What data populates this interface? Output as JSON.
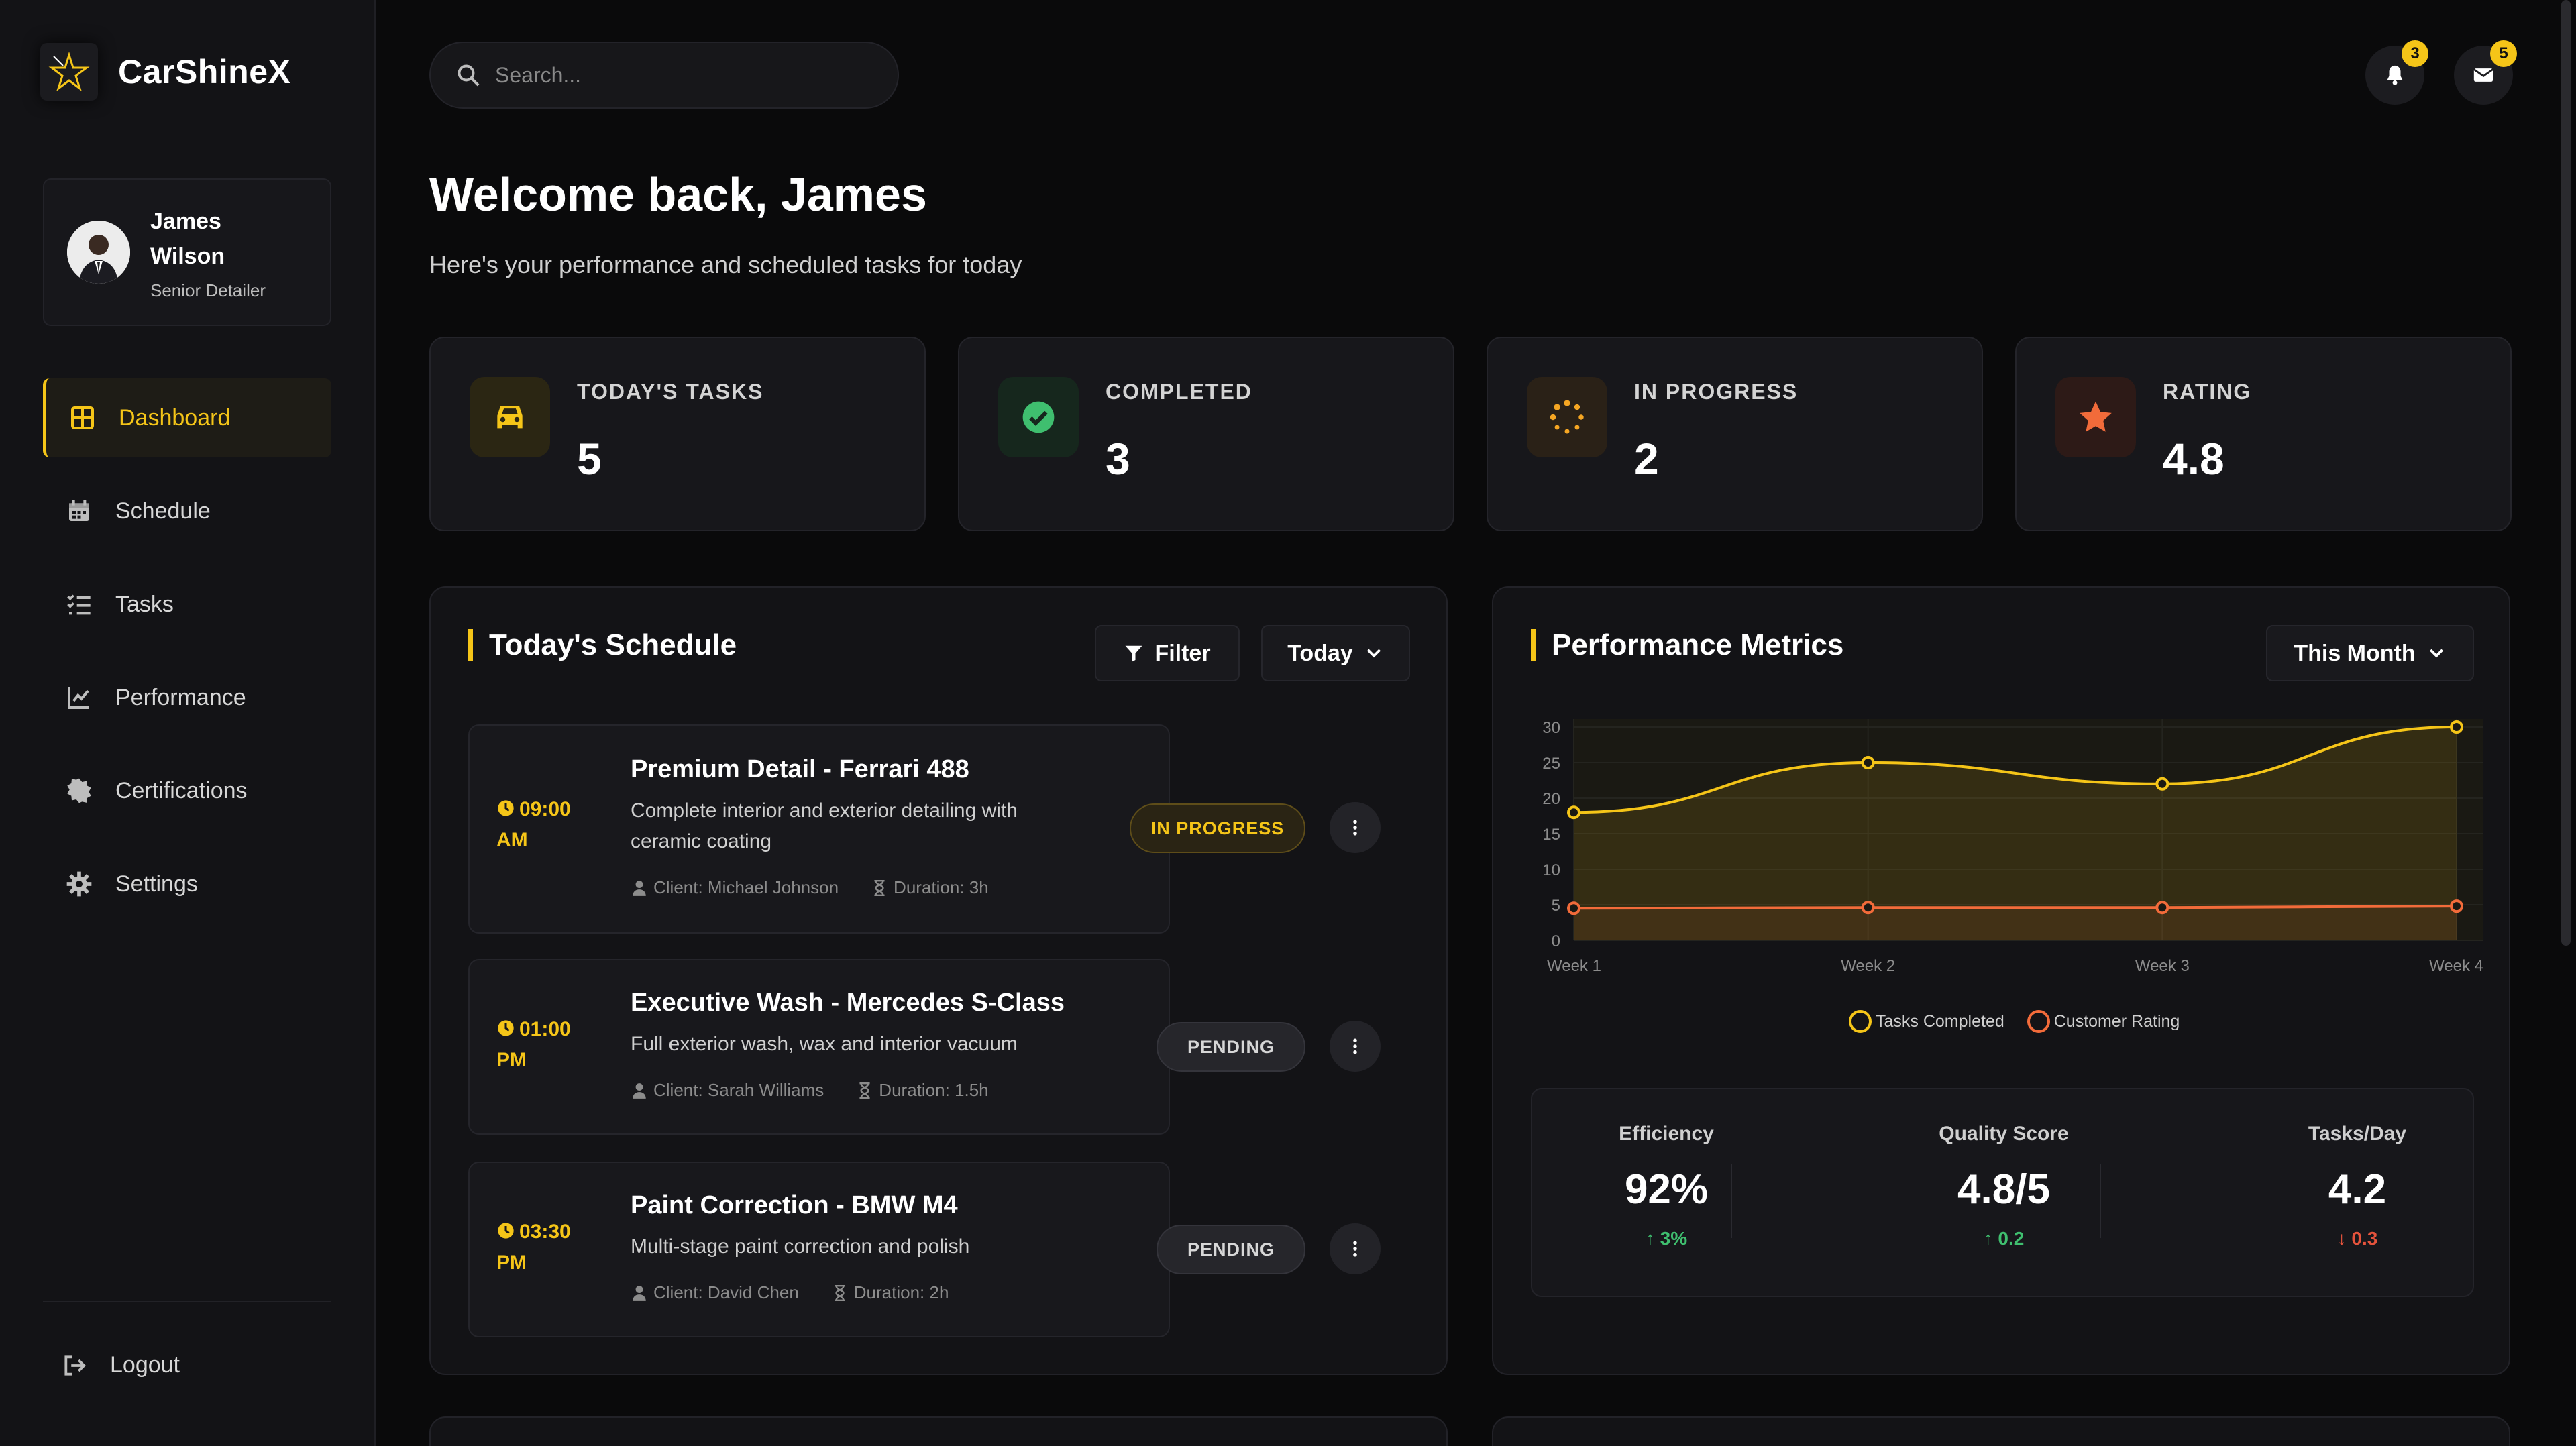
{
  "app": {
    "name": "CarShineX"
  },
  "user": {
    "name": "James Wilson",
    "role": "Senior Detailer"
  },
  "nav": [
    {
      "label": "Dashboard",
      "icon": "dashboard-icon",
      "active": true
    },
    {
      "label": "Schedule",
      "icon": "calendar-icon",
      "active": false
    },
    {
      "label": "Tasks",
      "icon": "task-list-icon",
      "active": false
    },
    {
      "label": "Performance",
      "icon": "chart-line-icon",
      "active": false
    },
    {
      "label": "Certifications",
      "icon": "certificate-icon",
      "active": false
    },
    {
      "label": "Settings",
      "icon": "gear-icon",
      "active": false
    }
  ],
  "logout_label": "Logout",
  "search": {
    "placeholder": "Search..."
  },
  "header": {
    "notifications_count": "3",
    "messages_count": "5"
  },
  "welcome": {
    "title": "Welcome back, James",
    "subtitle": "Here's your performance and scheduled tasks for today"
  },
  "stats": [
    {
      "label": "TODAY'S TASKS",
      "value": "5",
      "icon": "car-icon",
      "color": "#f5c518"
    },
    {
      "label": "COMPLETED",
      "value": "3",
      "icon": "check-circle-icon",
      "color": "#3fbf6f"
    },
    {
      "label": "IN PROGRESS",
      "value": "2",
      "icon": "spinner-icon",
      "color": "#f5a623"
    },
    {
      "label": "RATING",
      "value": "4.8",
      "icon": "star-icon",
      "color": "#f26b3a"
    }
  ],
  "schedule": {
    "title": "Today's Schedule",
    "filter_label": "Filter",
    "range_label": "Today",
    "tasks": [
      {
        "time": "09:00 AM",
        "title": "Premium Detail - Ferrari 488",
        "description": "Complete interior and exterior detailing with ceramic coating",
        "client": "Client: Michael Johnson",
        "duration": "Duration: 3h",
        "status": "IN PROGRESS"
      },
      {
        "time": "01:00 PM",
        "title": "Executive Wash - Mercedes S-Class",
        "description": "Full exterior wash, wax and interior vacuum",
        "client": "Client: Sarah Williams",
        "duration": "Duration: 1.5h",
        "status": "PENDING"
      },
      {
        "time": "03:30 PM",
        "title": "Paint Correction - BMW M4",
        "description": "Multi-stage paint correction and polish",
        "client": "Client: David Chen",
        "duration": "Duration: 2h",
        "status": "PENDING"
      }
    ]
  },
  "performance": {
    "title": "Performance Metrics",
    "range_label": "This Month",
    "metrics": [
      {
        "label": "Efficiency",
        "value": "92%",
        "delta": "3%",
        "direction": "up"
      },
      {
        "label": "Quality Score",
        "value": "4.8/5",
        "delta": "0.2",
        "direction": "up"
      },
      {
        "label": "Tasks/Day",
        "value": "4.2",
        "delta": "0.3",
        "direction": "down"
      }
    ]
  },
  "chart_data": {
    "type": "line",
    "categories": [
      "Week 1",
      "Week 2",
      "Week 3",
      "Week 4"
    ],
    "series": [
      {
        "name": "Tasks Completed",
        "values": [
          18,
          25,
          22,
          30
        ],
        "color": "#f5c518"
      },
      {
        "name": "Customer Rating",
        "values": [
          4.5,
          4.6,
          4.6,
          4.8
        ],
        "color": "#f26b3a"
      }
    ],
    "yticks": [
      0,
      5,
      10,
      15,
      20,
      25,
      30
    ],
    "ylim": [
      0,
      30
    ],
    "grid": true,
    "legend": "bottom"
  },
  "colors": {
    "accent": "#f5c518",
    "up": "#3fbf6f",
    "down": "#e5533c"
  }
}
